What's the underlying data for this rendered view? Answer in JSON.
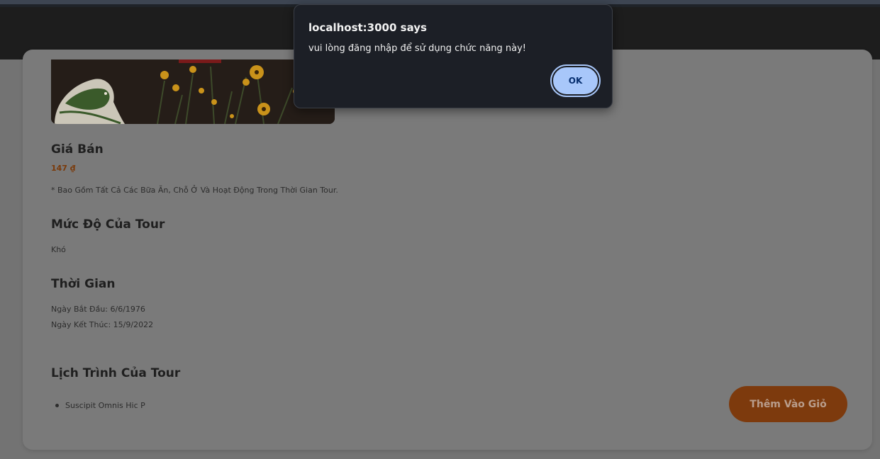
{
  "dialog": {
    "title": "localhost:3000 says",
    "message": "vui lòng đăng nhập để sử dụng chức năng này!",
    "ok_label": "OK"
  },
  "tour": {
    "price_heading": "Giá Bán",
    "price": "147 ₫",
    "price_note": "* Bao Gồm Tất Cả Các Bữa Ăn, Chỗ Ở Và Hoạt Động Trong Thời Gian Tour.",
    "level_heading": "Mức Độ Của Tour",
    "level": "Khó",
    "time_heading": "Thời Gian",
    "start_date": "Ngày Bắt Đầu: 6/6/1976",
    "end_date": "Ngày Kết Thúc: 15/9/2022",
    "itinerary_heading": "Lịch Trình Của Tour",
    "itinerary_items": [
      "Suscipit Omnis Hic P"
    ]
  },
  "actions": {
    "add_to_cart": "Thêm Vào Giỏ"
  },
  "colors": {
    "accent": "#7d3a0d",
    "price": "#7a3a0a",
    "dialog_button": "#a8c7fa"
  },
  "icons": {
    "logo": "bird-logo-icon"
  }
}
